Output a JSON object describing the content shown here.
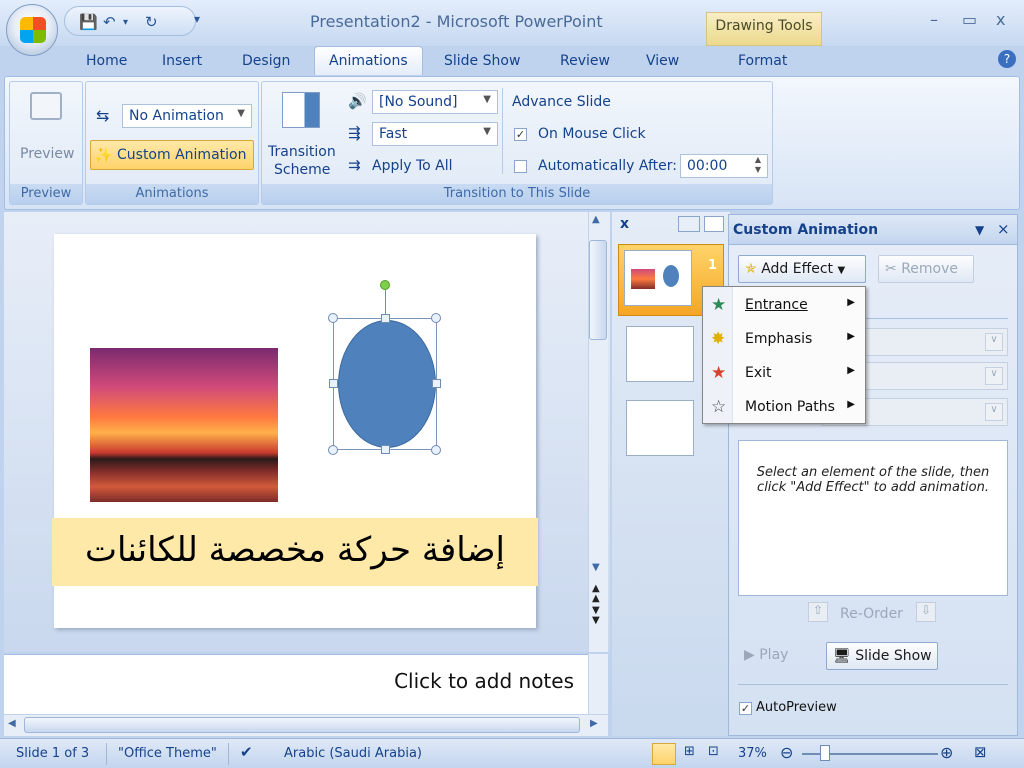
{
  "window": {
    "title": "Presentation2 - Microsoft PowerPoint",
    "contextual_tab": "Drawing Tools",
    "controls": {
      "minimize": "–",
      "maximize": "▭",
      "close": "x"
    }
  },
  "qat": {
    "save": "💾",
    "undo": "↶",
    "undo_drop": "▾",
    "redo": "↻",
    "customize": "▾"
  },
  "tabs": [
    "Home",
    "Insert",
    "Design",
    "Animations",
    "Slide Show",
    "Review",
    "View",
    "Format"
  ],
  "help": "?",
  "ribbon": {
    "preview": {
      "button": "Preview",
      "group": "Preview"
    },
    "animations": {
      "group": "Animations",
      "animate_value": "No Animation",
      "custom_animation": "Custom Animation"
    },
    "transition": {
      "group": "Transition to This Slide",
      "scheme_line1": "Transition",
      "scheme_line2": "Scheme",
      "sound_value": "[No Sound]",
      "speed_value": "Fast",
      "apply_all": "Apply To All",
      "advance_label": "Advance Slide",
      "on_mouse_click": "On Mouse Click",
      "on_mouse_click_checked": true,
      "auto_after": "Automatically After:",
      "auto_after_checked": false,
      "auto_time": "00:00"
    }
  },
  "slide": {
    "arabic_text": "إضافة حركة مخصصة للكائنات"
  },
  "notes": {
    "placeholder": "Click to add notes"
  },
  "thumbnails": {
    "close": "x",
    "slide_number": "1"
  },
  "custom_animation": {
    "title": "Custom Animation",
    "add_effect": "Add Effect",
    "remove": "Remove",
    "info": "Select an element of the slide, then click \"Add Effect\" to add animation.",
    "reorder": "Re-Order",
    "play": "Play",
    "slide_show": "Slide Show",
    "autopreview": "AutoPreview",
    "autopreview_checked": true
  },
  "add_effect_menu": [
    {
      "label": "Entrance",
      "icon": "green-star-icon",
      "color": "#2e8b57"
    },
    {
      "label": "Emphasis",
      "icon": "yellow-star-icon",
      "color": "#e0b000"
    },
    {
      "label": "Exit",
      "icon": "red-star-icon",
      "color": "#d8432f"
    },
    {
      "label": "Motion Paths",
      "icon": "outline-star-icon",
      "color": "#ffffff"
    }
  ],
  "status": {
    "slide_info": "Slide 1 of 3",
    "theme": "\"Office Theme\"",
    "language": "Arabic (Saudi Arabia)",
    "zoom": "37%"
  },
  "colors": {
    "accent": "#15428b",
    "shape_fill": "#4f81bd",
    "textbox_fill": "#fee9a8"
  }
}
